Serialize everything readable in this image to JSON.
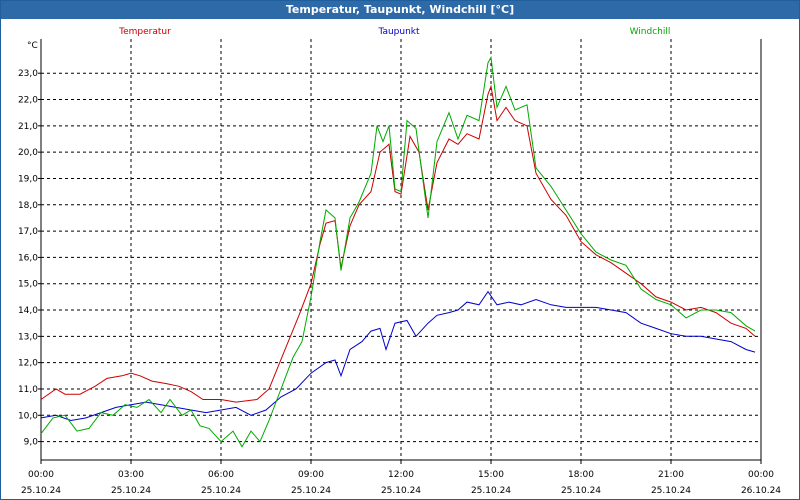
{
  "window": {
    "title": "Temperatur, Taupunkt, Windchill [°C]"
  },
  "chart_data": {
    "type": "line",
    "title": "Temperatur, Taupunkt, Windchill [°C]",
    "ylabel": "°C",
    "ylim": [
      8.3,
      24.3
    ],
    "xlim": [
      0,
      24
    ],
    "grid": true,
    "legend_position": "top",
    "y_ticks": [
      "9,0",
      "10,0",
      "11,0",
      "12,0",
      "13,0",
      "14,0",
      "15,0",
      "16,0",
      "17,0",
      "18,0",
      "19,0",
      "20,0",
      "21,0",
      "22,0",
      "23,0"
    ],
    "x_ticks": [
      {
        "time": "00:00",
        "date": "25.10.24"
      },
      {
        "time": "03:00",
        "date": "25.10.24"
      },
      {
        "time": "06:00",
        "date": "25.10.24"
      },
      {
        "time": "09:00",
        "date": "25.10.24"
      },
      {
        "time": "12:00",
        "date": "25.10.24"
      },
      {
        "time": "15:00",
        "date": "25.10.24"
      },
      {
        "time": "18:00",
        "date": "25.10.24"
      },
      {
        "time": "21:00",
        "date": "25.10.24"
      },
      {
        "time": "00:00",
        "date": "26.10.24"
      }
    ],
    "series": [
      {
        "name": "Temperatur",
        "color": "#cc0000",
        "points": [
          [
            0,
            10.6
          ],
          [
            0.5,
            11.0
          ],
          [
            0.8,
            10.8
          ],
          [
            1.3,
            10.8
          ],
          [
            1.8,
            11.1
          ],
          [
            2.2,
            11.4
          ],
          [
            2.7,
            11.5
          ],
          [
            3.0,
            11.6
          ],
          [
            3.3,
            11.5
          ],
          [
            3.7,
            11.3
          ],
          [
            4.2,
            11.2
          ],
          [
            4.6,
            11.1
          ],
          [
            5.0,
            10.9
          ],
          [
            5.4,
            10.6
          ],
          [
            6.0,
            10.6
          ],
          [
            6.5,
            10.5
          ],
          [
            7.2,
            10.6
          ],
          [
            7.6,
            11.0
          ],
          [
            8.1,
            12.4
          ],
          [
            8.6,
            13.8
          ],
          [
            9.0,
            15.0
          ],
          [
            9.3,
            16.5
          ],
          [
            9.5,
            17.3
          ],
          [
            9.8,
            17.4
          ],
          [
            10.0,
            15.6
          ],
          [
            10.3,
            17.2
          ],
          [
            10.6,
            18.0
          ],
          [
            11.0,
            18.5
          ],
          [
            11.3,
            20.0
          ],
          [
            11.6,
            20.3
          ],
          [
            11.8,
            18.5
          ],
          [
            12.0,
            18.4
          ],
          [
            12.3,
            20.6
          ],
          [
            12.6,
            20.0
          ],
          [
            12.9,
            17.8
          ],
          [
            13.2,
            19.6
          ],
          [
            13.6,
            20.5
          ],
          [
            13.9,
            20.3
          ],
          [
            14.2,
            20.7
          ],
          [
            14.6,
            20.5
          ],
          [
            14.9,
            22.2
          ],
          [
            15.0,
            22.5
          ],
          [
            15.2,
            21.2
          ],
          [
            15.5,
            21.7
          ],
          [
            15.8,
            21.2
          ],
          [
            16.2,
            21.0
          ],
          [
            16.5,
            19.2
          ],
          [
            17.0,
            18.2
          ],
          [
            17.5,
            17.6
          ],
          [
            18.0,
            16.6
          ],
          [
            18.5,
            16.1
          ],
          [
            19.0,
            15.8
          ],
          [
            19.5,
            15.4
          ],
          [
            20.0,
            15.0
          ],
          [
            20.5,
            14.5
          ],
          [
            21.0,
            14.3
          ],
          [
            21.5,
            14.0
          ],
          [
            22.0,
            14.1
          ],
          [
            22.5,
            13.9
          ],
          [
            23.0,
            13.5
          ],
          [
            23.5,
            13.3
          ],
          [
            23.8,
            13.0
          ]
        ]
      },
      {
        "name": "Taupunkt",
        "color": "#0000cc",
        "points": [
          [
            0,
            9.9
          ],
          [
            0.5,
            10.0
          ],
          [
            1.0,
            9.8
          ],
          [
            1.5,
            9.9
          ],
          [
            2.0,
            10.1
          ],
          [
            2.5,
            10.3
          ],
          [
            3.0,
            10.4
          ],
          [
            3.5,
            10.5
          ],
          [
            4.0,
            10.4
          ],
          [
            4.5,
            10.3
          ],
          [
            5.0,
            10.2
          ],
          [
            5.5,
            10.1
          ],
          [
            6.0,
            10.2
          ],
          [
            6.5,
            10.3
          ],
          [
            7.0,
            10.0
          ],
          [
            7.5,
            10.2
          ],
          [
            8.0,
            10.7
          ],
          [
            8.5,
            11.0
          ],
          [
            9.0,
            11.6
          ],
          [
            9.5,
            12.0
          ],
          [
            9.8,
            12.1
          ],
          [
            10.0,
            11.5
          ],
          [
            10.3,
            12.5
          ],
          [
            10.7,
            12.8
          ],
          [
            11.0,
            13.2
          ],
          [
            11.3,
            13.3
          ],
          [
            11.5,
            12.5
          ],
          [
            11.8,
            13.5
          ],
          [
            12.2,
            13.6
          ],
          [
            12.5,
            13.0
          ],
          [
            12.9,
            13.5
          ],
          [
            13.2,
            13.8
          ],
          [
            13.6,
            13.9
          ],
          [
            13.9,
            14.0
          ],
          [
            14.2,
            14.3
          ],
          [
            14.6,
            14.2
          ],
          [
            14.9,
            14.7
          ],
          [
            15.2,
            14.2
          ],
          [
            15.6,
            14.3
          ],
          [
            16.0,
            14.2
          ],
          [
            16.5,
            14.4
          ],
          [
            17.0,
            14.2
          ],
          [
            17.5,
            14.1
          ],
          [
            18.0,
            14.1
          ],
          [
            18.5,
            14.1
          ],
          [
            19.0,
            14.0
          ],
          [
            19.5,
            13.9
          ],
          [
            20.0,
            13.5
          ],
          [
            20.5,
            13.3
          ],
          [
            21.0,
            13.1
          ],
          [
            21.5,
            13.0
          ],
          [
            22.0,
            13.0
          ],
          [
            22.5,
            12.9
          ],
          [
            23.0,
            12.8
          ],
          [
            23.5,
            12.5
          ],
          [
            23.8,
            12.4
          ]
        ]
      },
      {
        "name": "Windchill",
        "color": "#00aa00",
        "points": [
          [
            0,
            9.3
          ],
          [
            0.4,
            9.9
          ],
          [
            0.8,
            10.0
          ],
          [
            1.2,
            9.4
          ],
          [
            1.6,
            9.5
          ],
          [
            2.0,
            10.1
          ],
          [
            2.4,
            10.0
          ],
          [
            2.8,
            10.4
          ],
          [
            3.2,
            10.3
          ],
          [
            3.6,
            10.6
          ],
          [
            4.0,
            10.1
          ],
          [
            4.3,
            10.6
          ],
          [
            4.7,
            10.0
          ],
          [
            5.0,
            10.2
          ],
          [
            5.3,
            9.6
          ],
          [
            5.6,
            9.5
          ],
          [
            6.0,
            9.0
          ],
          [
            6.4,
            9.4
          ],
          [
            6.7,
            8.8
          ],
          [
            7.0,
            9.4
          ],
          [
            7.3,
            9.0
          ],
          [
            7.6,
            9.8
          ],
          [
            8.0,
            11.0
          ],
          [
            8.4,
            12.2
          ],
          [
            8.7,
            12.8
          ],
          [
            9.0,
            14.5
          ],
          [
            9.3,
            16.6
          ],
          [
            9.5,
            17.8
          ],
          [
            9.8,
            17.5
          ],
          [
            10.0,
            15.5
          ],
          [
            10.3,
            17.5
          ],
          [
            10.6,
            18.1
          ],
          [
            11.0,
            19.2
          ],
          [
            11.2,
            21.0
          ],
          [
            11.4,
            20.4
          ],
          [
            11.6,
            21.0
          ],
          [
            11.8,
            18.6
          ],
          [
            12.0,
            18.5
          ],
          [
            12.2,
            21.2
          ],
          [
            12.5,
            20.9
          ],
          [
            12.9,
            17.5
          ],
          [
            13.2,
            20.4
          ],
          [
            13.6,
            21.5
          ],
          [
            13.9,
            20.5
          ],
          [
            14.2,
            21.4
          ],
          [
            14.6,
            21.2
          ],
          [
            14.9,
            23.4
          ],
          [
            15.0,
            23.6
          ],
          [
            15.2,
            21.7
          ],
          [
            15.5,
            22.5
          ],
          [
            15.8,
            21.6
          ],
          [
            16.2,
            21.8
          ],
          [
            16.5,
            19.4
          ],
          [
            17.0,
            18.7
          ],
          [
            17.5,
            17.8
          ],
          [
            18.0,
            16.9
          ],
          [
            18.5,
            16.2
          ],
          [
            19.0,
            15.9
          ],
          [
            19.5,
            15.7
          ],
          [
            20.0,
            14.8
          ],
          [
            20.5,
            14.4
          ],
          [
            21.0,
            14.2
          ],
          [
            21.5,
            13.7
          ],
          [
            22.0,
            14.0
          ],
          [
            22.5,
            14.0
          ],
          [
            23.0,
            13.9
          ],
          [
            23.5,
            13.4
          ],
          [
            23.8,
            13.2
          ]
        ]
      }
    ]
  }
}
